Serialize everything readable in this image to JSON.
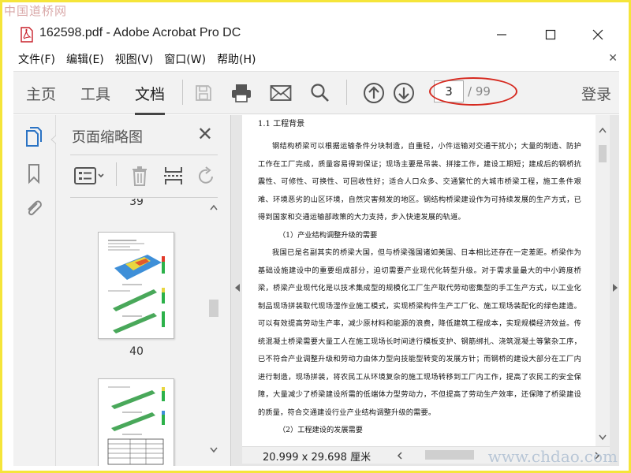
{
  "watermarks": {
    "top": "中国道桥网",
    "bottom": "www.chdao.com"
  },
  "window": {
    "title": "162598.pdf - Adobe Acrobat Pro DC"
  },
  "menu": {
    "items": [
      "文件(F)",
      "编辑(E)",
      "视图(V)",
      "窗口(W)",
      "帮助(H)"
    ]
  },
  "toolbar": {
    "tabs": [
      "主页",
      "工具",
      "文档"
    ],
    "active_tab": "文档",
    "current_page": "3",
    "total_pages": "/ 99",
    "login": "登录",
    "icons": [
      "save-icon",
      "print-icon",
      "mail-icon",
      "search-icon",
      "arrow-up-icon",
      "arrow-down-icon"
    ]
  },
  "thumbnails": {
    "title": "页面缩略图",
    "pages": [
      "39",
      "40"
    ]
  },
  "document": {
    "heading": "1.1 工程背景",
    "paragraph1": "钢结构桥梁可以根据运输条件分块制造，自重轻，小件运输对交通干扰小；大量的制造、防护工作在工厂完成，质量容易得到保证；现场主要是吊装、拼接工作，建设工期短；建成后的钢桥抗震性、可修性、可换性、可回收性好；适合人口众多、交通繁忙的大城市桥梁工程，施工条件艰难、环境恶劣的山区环境，自然灾害频发的地区。钢结构桥梁建设作为可持续发展的生产方式，已得到国家和交通运输部政策的大力支持，步入快速发展的轨道。",
    "subheading": "（1）产业结构调整升级的需要",
    "paragraph2": "我国已是名副其实的桥梁大国，但与桥梁强国诸如美国、日本相比还存在一定差距。桥梁作为基础设施建设中的重要组成部分，迫切需要产业现代化转型升级。对于需求量最大的中小跨度桥梁，桥梁产业现代化是以技术集成型的规模化工厂生产取代劳动密集型的手工生产方式，以工业化制品现场拼装取代现场湿作业施工模式，实现桥梁构件生产工厂化、施工现场装配化的绿色建造。可以有效提高劳动生产率，减少原材料和能源的浪费，降低建筑工程成本，实现规模经济效益。传统混凝土桥梁需要大量工人在施工现场长时间进行模板支护、钢筋绑扎、浇筑混凝土等繁杂工序，已不符合产业调整升级和劳动力由体力型向技能型转变的发展方针；而钢桥的建设大部分在工厂内进行制造，现场拼装，将农民工从环境复杂的施工现场转移到工厂内工作，提高了农民工的安全保障，大量减少了桥梁建设所需的低端体力型劳动力，不但提高了劳动生产效率，还保障了桥梁建设的质量，符合交通建设行业产业结构调整升级的需要。",
    "partial_line": "（2）工程建设的发展需要"
  },
  "status": {
    "page_size": "20.999 x 29.698 厘米"
  }
}
